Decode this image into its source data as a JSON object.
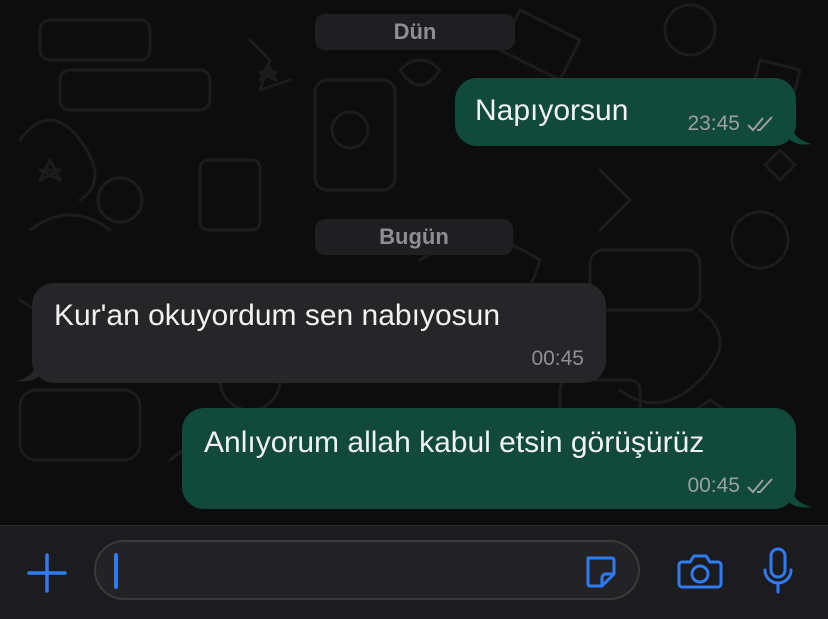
{
  "colors": {
    "outgoing_bubble": "#11493a",
    "incoming_bubble": "#262628",
    "accent": "#2f7bf6",
    "background": "#0d0d0d"
  },
  "dates": {
    "yesterday": "Dün",
    "today": "Bugün"
  },
  "messages": [
    {
      "direction": "outgoing",
      "text": "Napıyorsun",
      "time": "23:45",
      "status": "read-double-check"
    },
    {
      "direction": "incoming",
      "text": "Kur'an okuyordum sen nabıyosun",
      "time": "00:45"
    },
    {
      "direction": "outgoing",
      "text": "Anlıyorum allah kabul etsin görüşürüz",
      "time": "00:45",
      "status": "read-double-check"
    }
  ],
  "composer": {
    "input_value": "",
    "icons": [
      "plus-icon",
      "sticker-icon",
      "camera-icon",
      "microphone-icon"
    ]
  }
}
